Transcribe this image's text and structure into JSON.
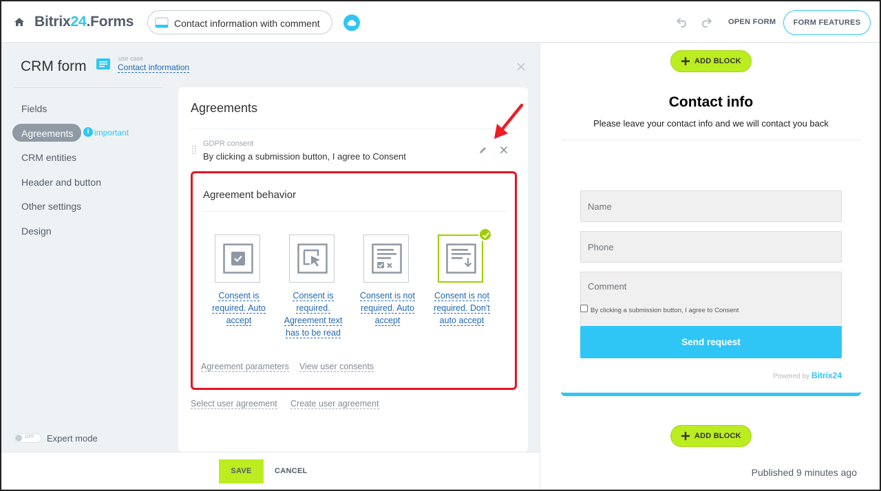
{
  "header": {
    "brand_main": "Bitrix",
    "brand_num": "24",
    "brand_suffix": ".Forms",
    "form_name": "Contact information with comment",
    "open_form": "OPEN FORM",
    "form_features": "FORM FEATURES"
  },
  "panel": {
    "title": "CRM form",
    "usecase_label": "use case",
    "usecase_value": "Contact information"
  },
  "nav": {
    "items": [
      "Fields",
      "Agreements",
      "CRM entities",
      "Header and button",
      "Other settings",
      "Design"
    ],
    "active_note": "important",
    "expert_mode": "Expert mode",
    "toggle_state": "OFF"
  },
  "agreements": {
    "title": "Agreements",
    "item_label": "GDPR consent",
    "item_text": "By clicking a submission button, I agree to Consent",
    "behavior": {
      "title": "Agreement behavior",
      "options": [
        {
          "label": "Consent is required. Auto accept",
          "selected": false
        },
        {
          "label": "Consent is required. Agreement text has to be read",
          "selected": false
        },
        {
          "label": "Consent is not required. Auto accept",
          "selected": false
        },
        {
          "label": "Consent is not required. Don't auto accept",
          "selected": true
        }
      ],
      "link_params": "Agreement parameters",
      "link_consents": "View user consents"
    },
    "link_select": "Select user agreement",
    "link_create": "Create user agreement"
  },
  "footer": {
    "save": "SAVE",
    "cancel": "CANCEL"
  },
  "preview": {
    "add_block": "ADD BLOCK",
    "title": "Contact info",
    "subtitle": "Please leave your contact info and we will contact you back",
    "fields": [
      "Name",
      "Phone",
      "Comment"
    ],
    "consent": "By clicking a submission button, I agree to Consent",
    "submit": "Send request",
    "powered_by": "Powered by",
    "powered_brand": "Bitrix24",
    "published": "Published 9 minutes ago"
  },
  "colors": {
    "accent": "#2fc6f6",
    "green": "#bbed21",
    "highlight": "#e8121e",
    "link": "#2067b0"
  }
}
